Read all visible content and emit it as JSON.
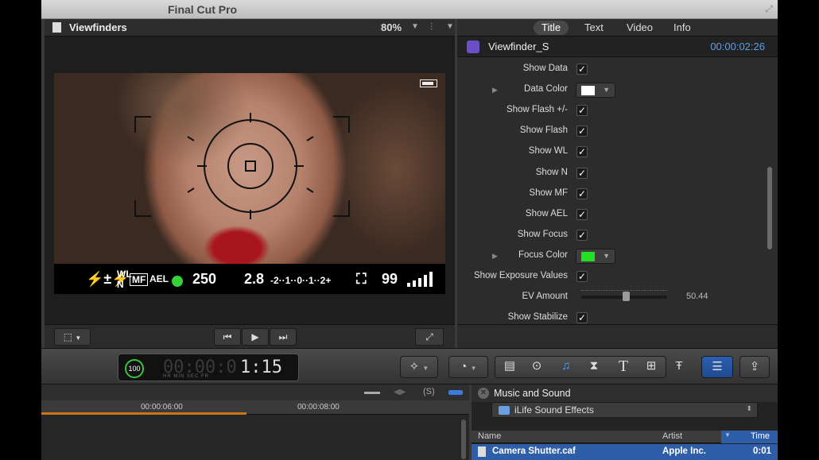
{
  "window": {
    "title": "Final Cut Pro"
  },
  "viewer": {
    "name": "Viewfinders",
    "zoom": "80%",
    "info_strip": {
      "flash": "⚡±⚡",
      "wb": "WL",
      "wb_sub": "N",
      "mf": "MF",
      "ael": "AEL",
      "shutter": "250",
      "aperture": "2.8",
      "scale": "-2··1··0··1··2+",
      "shots": "99"
    }
  },
  "inspector": {
    "tabs": [
      "Title",
      "Text",
      "Video",
      "Info"
    ],
    "active_tab": "Title",
    "clip_name": "Viewfinder_S",
    "timecode": "00:00:02:26",
    "properties": [
      {
        "label": "Show Data",
        "kind": "check",
        "checked": true
      },
      {
        "label": "Data Color",
        "kind": "color",
        "color": "#ffffff"
      },
      {
        "label": "Show Flash +/-",
        "kind": "check",
        "checked": true
      },
      {
        "label": "Show Flash",
        "kind": "check",
        "checked": true
      },
      {
        "label": "Show WL",
        "kind": "check",
        "checked": true
      },
      {
        "label": "Show N",
        "kind": "check",
        "checked": true
      },
      {
        "label": "Show MF",
        "kind": "check",
        "checked": true
      },
      {
        "label": "Show AEL",
        "kind": "check",
        "checked": true
      },
      {
        "label": "Show Focus",
        "kind": "check",
        "checked": true
      },
      {
        "label": "Focus Color",
        "kind": "color",
        "color": "#22e022"
      },
      {
        "label": "Show Exposure Values",
        "kind": "check",
        "checked": true
      },
      {
        "label": "EV Amount",
        "kind": "slider",
        "value": "50.44"
      },
      {
        "label": "Show Stabilize",
        "kind": "check",
        "checked": true
      }
    ]
  },
  "toolbar": {
    "timecode_dim": "00:00:0",
    "timecode_lit": "1:15",
    "timecode_units": "HR     MIN     SEC     FR",
    "progress_label": "100"
  },
  "timeline": {
    "ticks": [
      "00:00:06:00",
      "00:00:08:00"
    ]
  },
  "browser": {
    "title": "Music and Sound",
    "source": "iLife Sound Effects",
    "columns": {
      "name": "Name",
      "artist": "Artist",
      "time": "Time"
    },
    "rows": [
      {
        "name": "Camera Shutter.caf",
        "artist": "Apple Inc.",
        "time": "0:01"
      }
    ]
  }
}
